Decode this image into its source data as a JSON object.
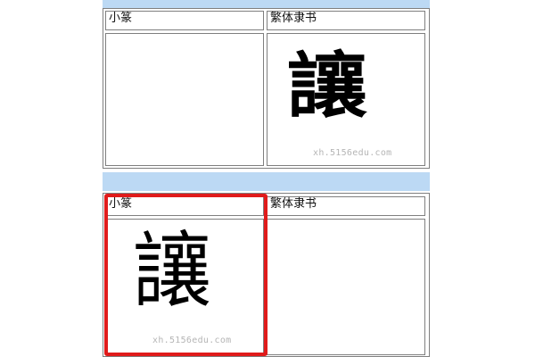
{
  "sections": [
    {
      "headers": [
        "小篆",
        "繁体隶书"
      ],
      "cells": [
        {
          "glyph": "",
          "watermark": ""
        },
        {
          "glyph": "讓",
          "watermark": "xh.5156edu.com"
        }
      ]
    },
    {
      "headers": [
        "小篆",
        "繁体隶书"
      ],
      "cells": [
        {
          "glyph": "讓",
          "watermark": "xh.5156edu.com"
        },
        {
          "glyph": "",
          "watermark": ""
        }
      ]
    }
  ],
  "colors": {
    "band": "#bcd9f4",
    "border": "#7f7f7f",
    "highlight": "#e01b1b",
    "watermark": "#b5b5b5"
  },
  "highlighted_cell": "section-2-seal-cell"
}
